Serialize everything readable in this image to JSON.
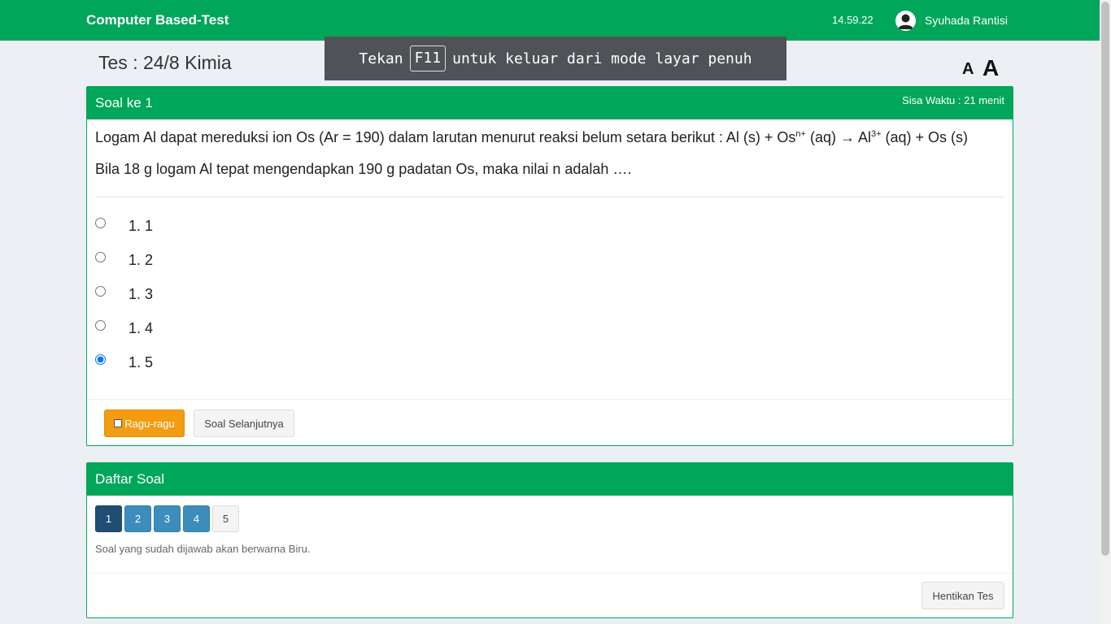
{
  "navbar": {
    "brand": "Computer Based-Test",
    "clock": "14.59.22",
    "user_icon": "user-avatar-icon",
    "username": "Syuhada Rantisi"
  },
  "fullscreen_banner": {
    "before": "Tekan",
    "key": "F11",
    "after": "untuk keluar dari mode layar penuh"
  },
  "test": {
    "title": "Tes : 24/8 Kimia",
    "font_small": "A",
    "font_large": "A"
  },
  "question": {
    "header": "Soal ke 1",
    "timer": "Sisa Waktu : 21 menit",
    "line1_a": "Logam Al dapat mereduksi ion Os (Ar = 190) dalam larutan menurut reaksi belum setara berikut : Al (s) + Os",
    "line1_sup1": "n+",
    "line1_b": " (aq) → Al",
    "line1_sup2": "3+",
    "line1_c": " (aq) + Os (s)",
    "line2": "Bila 18 g logam Al tepat mengendapkan 190 g padatan Os, maka nilai n adalah ….",
    "options": [
      {
        "label": "1. 1",
        "checked": false
      },
      {
        "label": "1. 2",
        "checked": false
      },
      {
        "label": "1. 3",
        "checked": false
      },
      {
        "label": "1. 4",
        "checked": false
      },
      {
        "label": "1. 5",
        "checked": true
      }
    ],
    "ragu_label": "Ragu-ragu",
    "next_label": "Soal Selanjutnya"
  },
  "question_list": {
    "header": "Daftar Soal",
    "numbers": [
      {
        "label": "1",
        "state": "active"
      },
      {
        "label": "2",
        "state": "answered"
      },
      {
        "label": "3",
        "state": "answered"
      },
      {
        "label": "4",
        "state": "answered"
      },
      {
        "label": "5",
        "state": "empty"
      }
    ],
    "hint": "Soal yang sudah dijawab akan berwarna Biru.",
    "stop_label": "Hentikan Tes"
  },
  "colors": {
    "primary_green": "#00a65a",
    "warning_orange": "#f39c12",
    "answered_blue": "#3c8dbc",
    "active_blue": "#204d74"
  }
}
